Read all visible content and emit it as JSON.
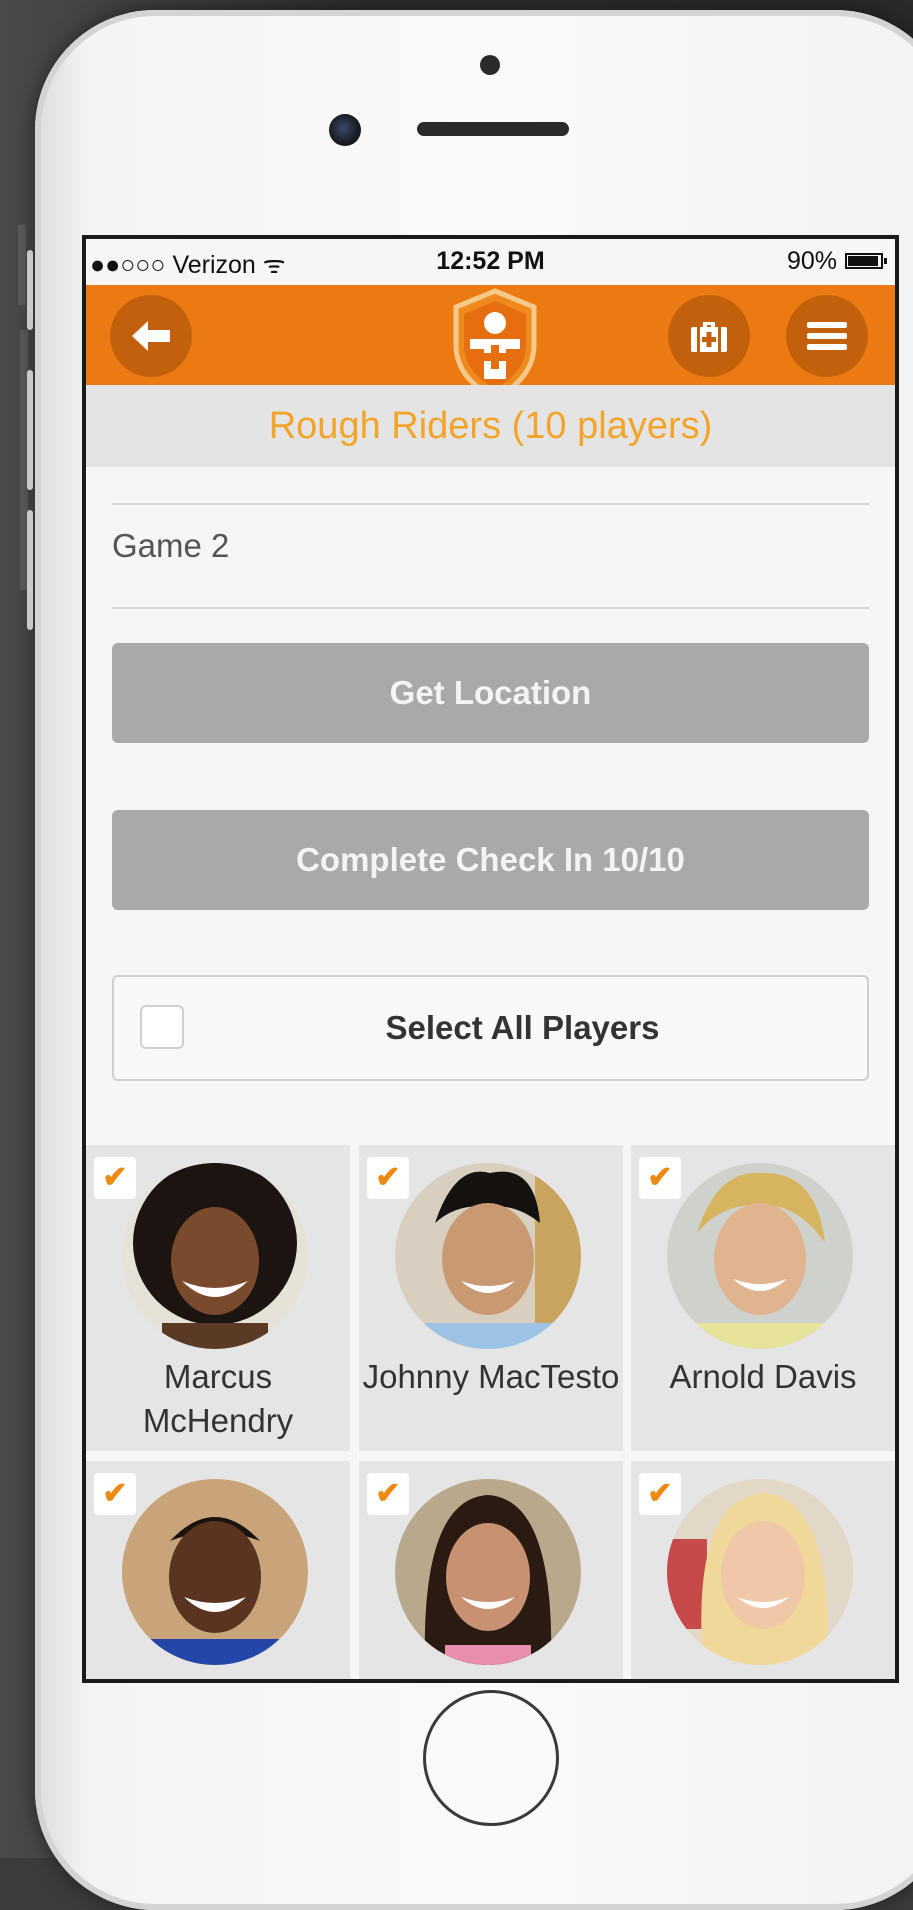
{
  "status_bar": {
    "carrier": "●●○○○ Verizon ᯤ",
    "time": "12:52 PM",
    "battery": "90%"
  },
  "nav": {
    "back_icon": "arrow-left-icon",
    "logo_icon": "shield-medical-person-icon",
    "firstaid_icon": "first-aid-kit-icon",
    "menu_icon": "hamburger-menu-icon"
  },
  "team": {
    "title": "Rough Riders (10 players)"
  },
  "form": {
    "game_name": "Game 2",
    "get_location_label": "Get Location",
    "complete_label": "Complete Check In 10/10",
    "select_all_label": "Select All Players",
    "select_all_checked": false
  },
  "players": [
    {
      "name": "Marcus McHendry",
      "checked": true
    },
    {
      "name": "Johnny MacTesto",
      "checked": true
    },
    {
      "name": "Arnold Davis",
      "checked": true
    },
    {
      "name": "",
      "checked": true
    },
    {
      "name": "",
      "checked": true
    },
    {
      "name": "",
      "checked": true
    }
  ],
  "colors": {
    "accent": "#ec7a12",
    "nav_button": "#c2600c",
    "team_title": "#f2a52a",
    "disabled_button": "#a9a9a9",
    "check": "#ec8a14"
  }
}
